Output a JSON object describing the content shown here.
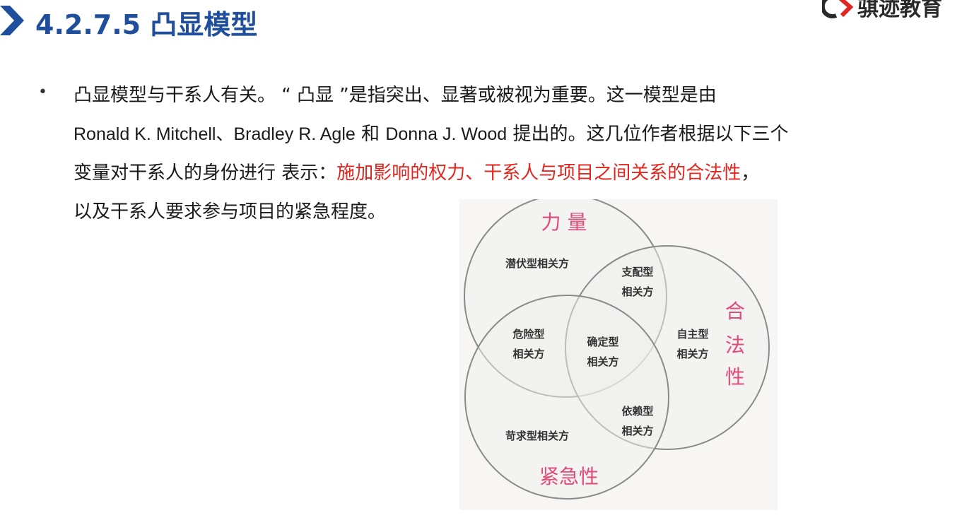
{
  "header": {
    "title": "4.2.7.5 凸显模型",
    "brand_name": "骐迹教育",
    "chevron_icon": "chevron-right-icon",
    "logo_icon": "brand-logo-icon",
    "accent_color": "#1f4e9c"
  },
  "content": {
    "bullet": "•",
    "line1": "凸显模型与干系人有关。 “ 凸显 ”是指突出、显著或被视为重要。这一模型是由",
    "line2_authors": "Ronald K. Mitchell、Bradley R. Agle",
    "line2_and": " 和 ",
    "line2_author3": "Donna J. Wood",
    "line2_rest": " 提出的。这几位作者根据以下三个",
    "line3_plain": "变量对干系人的身份进行  表示：",
    "line3_highlight": "施加影响的权力、干系人与项目之间关系的合法性",
    "line3_end": "，",
    "line4": "以及干系人要求参与项目的紧急程度。",
    "highlight_color": "#e0261f"
  },
  "venn": {
    "var_power": "力 量",
    "var_legitimacy_1": "合",
    "var_legitimacy_2": "法",
    "var_legitimacy_3": "性",
    "var_urgency": "紧急性",
    "latent": "潜伏型相关方",
    "dominant_1": "支配型",
    "dominant_2": "相关方",
    "discretionary_1": "自主型",
    "discretionary_2": "相关方",
    "dangerous_1": "危险型",
    "dangerous_2": "相关方",
    "definitive_1": "确定型",
    "definitive_2": "相关方",
    "dependent_1": "依赖型",
    "dependent_2": "相关方",
    "demanding": "苛求型相关方",
    "label_color": "#e04b79"
  }
}
